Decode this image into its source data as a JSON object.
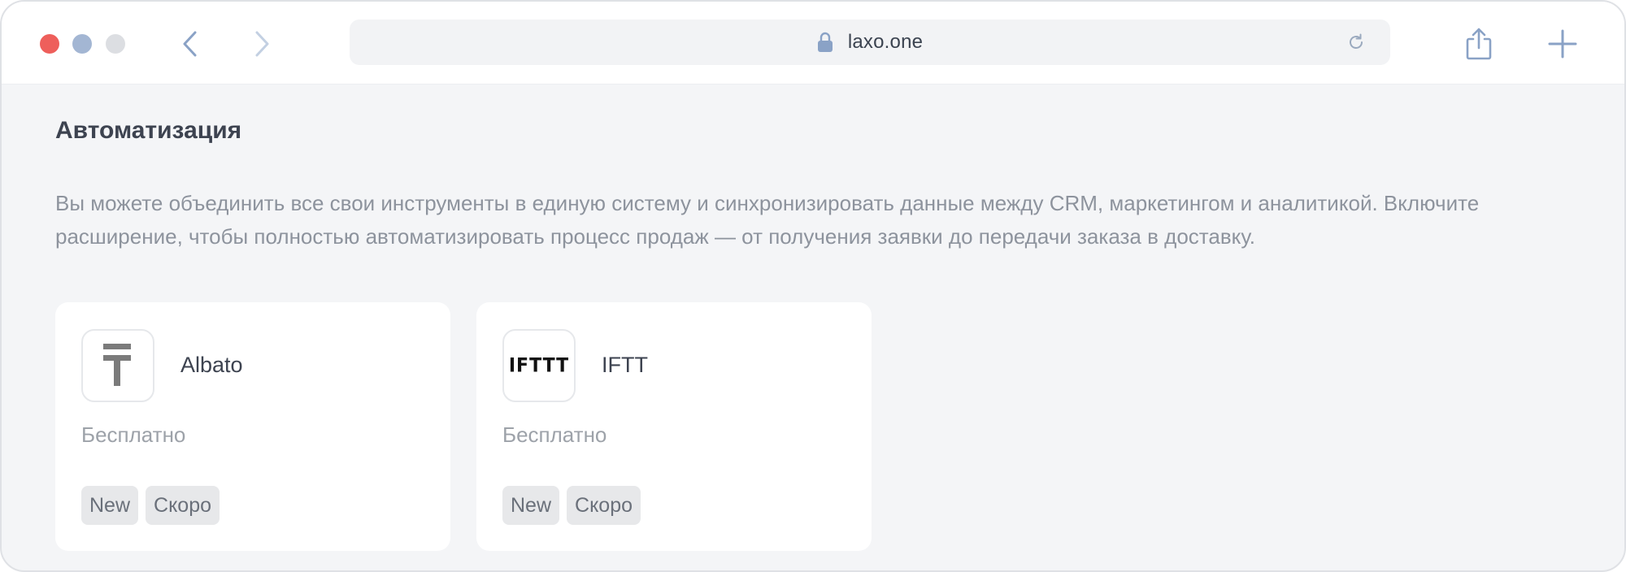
{
  "browser": {
    "url": "laxo.one"
  },
  "section": {
    "title": "Автоматизация",
    "description": "Вы можете объединить все свои инструменты в единую систему и синхронизировать данные между CRM, маркетингом и аналитикой. Включите расширение, чтобы полностью автоматизировать процесс продаж — от получения заявки до передачи заказа в доставку."
  },
  "cards": [
    {
      "name": "Albato",
      "price": "Бесплатно",
      "badges": [
        "New",
        "Скоро"
      ],
      "icon": "albato-logo-icon"
    },
    {
      "name": "IFTT",
      "price": "Бесплатно",
      "badges": [
        "New",
        "Скоро"
      ],
      "icon": "ifttt-logo-icon",
      "logo_text": "IFTTT"
    }
  ],
  "colors": {
    "close": "#ee5f5b",
    "accent": "#a3b6d3",
    "background": "#f4f5f7",
    "card": "#ffffff"
  }
}
